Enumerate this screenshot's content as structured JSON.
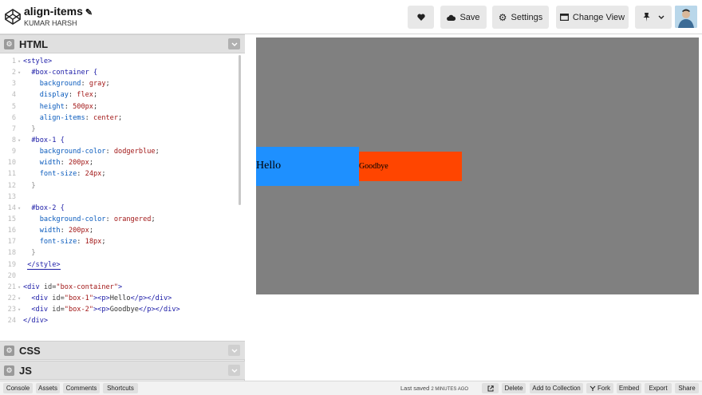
{
  "header": {
    "title": "align-items",
    "author": "KUMAR HARSH",
    "buttons": {
      "save": "Save",
      "settings": "Settings",
      "change_view": "Change View"
    }
  },
  "editors": {
    "html_label": "HTML",
    "css_label": "CSS",
    "js_label": "JS",
    "line_numbers": [
      "1",
      "2",
      "3",
      "4",
      "5",
      "6",
      "7",
      "8",
      "9",
      "10",
      "11",
      "12",
      "13",
      "14",
      "15",
      "16",
      "17",
      "18",
      "19",
      "20",
      "21",
      "22",
      "23",
      "24"
    ],
    "code": {
      "l1": "<style>",
      "l2": "#box-container {",
      "l3a": "background",
      "l3b": "gray",
      "l4a": "display",
      "l4b": "flex",
      "l5a": "height",
      "l5b": "500px",
      "l6a": "align-items",
      "l6b": "center",
      "l7": "}",
      "l8": "#box-1 {",
      "l9a": "background-color",
      "l9b": "dodgerblue",
      "l10a": "width",
      "l10b": "200px",
      "l11a": "font-size",
      "l11b": "24px",
      "l12": "}",
      "l14": "#box-2 {",
      "l15a": "background-color",
      "l15b": "orangered",
      "l16a": "width",
      "l16b": "200px",
      "l17a": "font-size",
      "l17b": "18px",
      "l18": "}",
      "l19": "</style>",
      "l21a": "<div ",
      "l21b": "id",
      "l21c": "\"box-container\"",
      "l21d": ">",
      "l22a": "<div ",
      "l22b": "id",
      "l22c": "\"box-1\"",
      "l22d": "><p>",
      "l22e": "Hello",
      "l22f": "</p></div>",
      "l23a": "<div ",
      "l23b": "id",
      "l23c": "\"box-2\"",
      "l23d": "><p>",
      "l23e": "Goodbye",
      "l23f": "</p></div>",
      "l24": "</div>"
    }
  },
  "preview": {
    "box1_text": "Hello",
    "box2_text": "Goodbye",
    "colors": {
      "container": "#808080",
      "box1": "#1e90ff",
      "box2": "#ff4500"
    }
  },
  "footer": {
    "console": "Console",
    "assets": "Assets",
    "comments": "Comments",
    "shortcuts": "Shortcuts",
    "saved_prefix": "Last saved",
    "saved_time": "2 MINUTES AGO",
    "delete": "Delete",
    "add_to_collection": "Add to Collection",
    "fork": "Fork",
    "embed": "Embed",
    "export": "Export",
    "share": "Share"
  },
  "icons": [
    "codepen-logo-icon",
    "pencil-icon",
    "heart-icon",
    "cloud-icon",
    "gear-icon",
    "layout-icon",
    "pin-icon",
    "chevron-down-icon",
    "external-link-icon",
    "fork-icon"
  ]
}
